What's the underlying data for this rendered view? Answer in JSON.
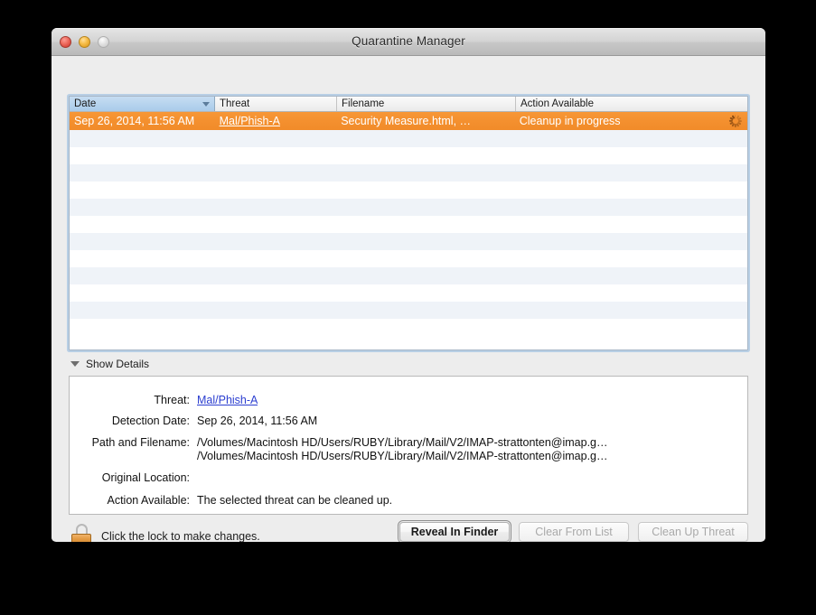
{
  "window": {
    "title": "Quarantine Manager",
    "controls": {
      "close": "close-button",
      "minimize": "minimize-button",
      "zoom": "zoom-button"
    }
  },
  "table": {
    "columns": [
      {
        "label": "Date",
        "sorted": true,
        "sort_direction": "descending"
      },
      {
        "label": "Threat",
        "sorted": false
      },
      {
        "label": "Filename",
        "sorted": false
      },
      {
        "label": "Action Available",
        "sorted": false
      }
    ],
    "rows": [
      {
        "date": "Sep 26, 2014, 11:56 AM",
        "threat": "Mal/Phish-A",
        "filename": "Security Measure.html, …",
        "action": "Cleanup in progress",
        "busy_icon": "spinner-icon",
        "selected": true
      }
    ],
    "empty_row_count": 12
  },
  "disclosure": {
    "label": "Show Details",
    "icon": "triangle-down-icon",
    "expanded": true
  },
  "details": {
    "threat_label": "Threat:",
    "threat_value": "Mal/Phish-A",
    "detection_date_label": "Detection Date:",
    "detection_date_value": "Sep 26, 2014, 11:56 AM",
    "path_label": "Path and Filename:",
    "path_value_1": "/Volumes/Macintosh HD/Users/RUBY/Library/Mail/V2/IMAP-strattonten@imap.g…",
    "path_value_2": "/Volumes/Macintosh HD/Users/RUBY/Library/Mail/V2/IMAP-strattonten@imap.g…",
    "original_location_label": "Original Location:",
    "original_location_value": "",
    "action_label": "Action Available:",
    "action_value": "The selected threat can be cleaned up."
  },
  "footer": {
    "lock_icon": "lock-closed-icon",
    "lock_text": "Click the lock to make changes.",
    "buttons": [
      {
        "label": "Reveal In Finder",
        "enabled": true,
        "default": true
      },
      {
        "label": "Clear From List",
        "enabled": false,
        "default": false
      },
      {
        "label": "Clean Up Threat",
        "enabled": false,
        "default": false
      }
    ]
  },
  "colors": {
    "selection": "#f4902f",
    "link": "#2b3ed0",
    "stripe": "#eff3f8",
    "header_sorted": "#a9cbea"
  }
}
